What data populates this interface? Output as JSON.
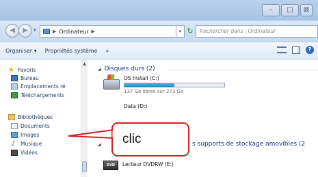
{
  "window": {
    "minimize_glyph": "–",
    "maximize_glyph": "□",
    "close_glyph": "⊠"
  },
  "address": {
    "back_glyph": "◀",
    "forward_glyph": "▶",
    "dropdown_glyph": "▾",
    "path_separator": "▶",
    "path_item": "Ordinateur",
    "path_dropdown_glyph": "▾",
    "refresh_glyph": "↻",
    "search_placeholder": "Rechercher dans : Ordinateur",
    "icons": {
      "computer": "computer-icon",
      "refresh": "refresh-icon"
    }
  },
  "toolbar": {
    "organize": "Organiser ▾",
    "system_properties": "Propriétés système",
    "more": "»",
    "help_glyph": "?"
  },
  "navigation": {
    "favorites_label": "Favoris",
    "favorites": [
      "Bureau",
      "Emplacements ré",
      "Téléchargements"
    ],
    "libraries_label": "Bibliothèques",
    "libraries": [
      "Documents",
      "Images",
      "Musique",
      "Vidéos"
    ],
    "scroll_up_glyph": "▲"
  },
  "content": {
    "hard_disks_header": "Disques durs (2)",
    "drives": [
      {
        "name": "OS Install (C:)",
        "free": "137 Go libres sur 273 Go",
        "used_fraction": 0.5
      },
      {
        "name": "Data (D:)",
        "free": ""
      }
    ],
    "removable_header": "s supports de stockage amovibles (2",
    "dvd": {
      "name": "Lecteur DVDRW (E:)",
      "label": "DVD"
    }
  },
  "annotation": {
    "text": "clic",
    "color": "#d42020"
  }
}
